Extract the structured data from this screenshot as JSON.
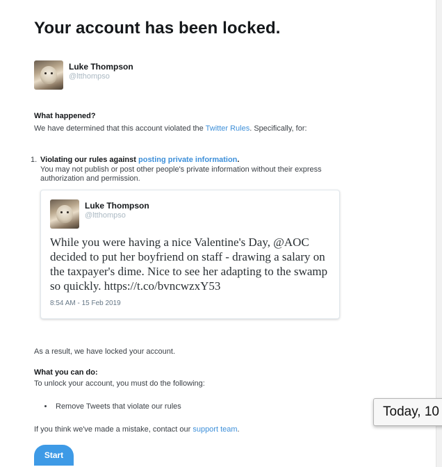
{
  "page": {
    "title": "Your account has been locked.",
    "account": {
      "name": "Luke Thompson",
      "handle": "@ltthompso"
    }
  },
  "what_happened": {
    "heading": "What happened?",
    "text_before": "We have determined that this account violated the ",
    "link": "Twitter Rules",
    "text_after": ". Specifically, for:"
  },
  "violation": {
    "number": "1.",
    "heading_before": "Violating our rules against ",
    "heading_link": "posting private information",
    "heading_after": ".",
    "description_line1": "You may not publish or post other people's private information without their express",
    "description_line2": "authorization and permission."
  },
  "tweet": {
    "name": "Luke Thompson",
    "handle": "@ltthompso",
    "text": "While you were having a nice Valentine's Day, @AOC decided to put her boyfriend on staff - drawing a salary on the taxpayer's dime. Nice to see her adapting to the swamp so quickly. https://t.co/bvncwzxY53",
    "timestamp": "8:54 AM - 15 Feb 2019"
  },
  "result_text": "As a result, we have locked your account.",
  "what_you_can_do": {
    "heading": "What you can do:",
    "text": "To unlock your account, you must do the following:",
    "steps": [
      "Remove Tweets that violate our rules"
    ]
  },
  "mistake": {
    "text_before": "If you think we've made a mistake, contact our ",
    "link": "support team",
    "text_after": "."
  },
  "start_button": "Start",
  "tooltip": "Today, 10"
}
